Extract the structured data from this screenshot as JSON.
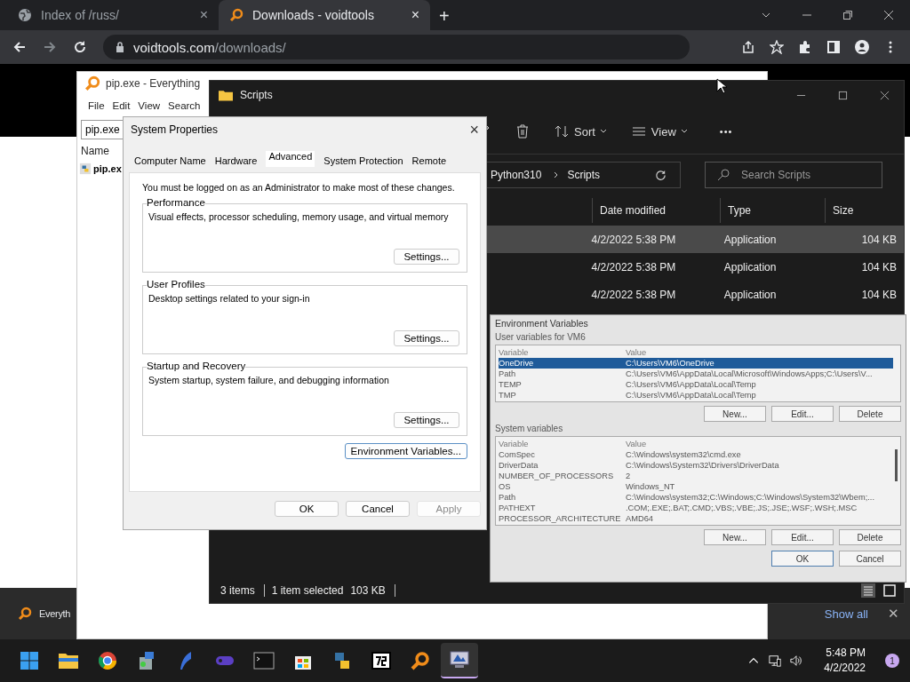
{
  "browser": {
    "tabs": [
      {
        "title": "Index of /russ/",
        "close": "×",
        "selected": false
      },
      {
        "title": "Downloads - voidtools",
        "close": "×",
        "selected": true
      }
    ],
    "new_tab": "+",
    "url_host": "voidtools.com",
    "url_path": "/downloads/"
  },
  "download_bar": {
    "item": "Everyth",
    "show_all": "Show all",
    "close": "✕"
  },
  "everything": {
    "title": "pip.exe - Everything",
    "menu": [
      "File",
      "Edit",
      "View",
      "Search"
    ],
    "search": "pip.exe",
    "column": "Name",
    "rows": [
      {
        "name": "pip.ex"
      }
    ]
  },
  "explorer": {
    "title": "Scripts",
    "toolbar": {
      "sort": "Sort",
      "view": "View",
      "more": "•••"
    },
    "breadcrumb": [
      "Python310",
      "Scripts"
    ],
    "search_placeholder": "Search Scripts",
    "columns": [
      "Date modified",
      "Type",
      "Size"
    ],
    "rows": [
      {
        "date": "4/2/2022 5:38 PM",
        "type": "Application",
        "size": "104 KB",
        "selected": true
      },
      {
        "date": "4/2/2022 5:38 PM",
        "type": "Application",
        "size": "104 KB",
        "selected": false
      },
      {
        "date": "4/2/2022 5:38 PM",
        "type": "Application",
        "size": "104 KB",
        "selected": false
      }
    ],
    "status": {
      "count": "3 items",
      "selection": "1 item selected",
      "size": "103 KB"
    }
  },
  "env_vars": {
    "title": "Environment Variables",
    "user_label": "User variables for VM6",
    "user_columns": [
      "Variable",
      "Value"
    ],
    "system_columns": [
      "Variable",
      "Value"
    ],
    "user_rows": [
      {
        "name": "OneDrive",
        "value": "C:\\Users\\VM6\\OneDrive",
        "selected": true
      },
      {
        "name": "Path",
        "value": "C:\\Users\\VM6\\AppData\\Local\\Microsoft\\WindowsApps;C:\\Users\\V...",
        "selected": false
      },
      {
        "name": "TEMP",
        "value": "C:\\Users\\VM6\\AppData\\Local\\Temp",
        "selected": false
      },
      {
        "name": "TMP",
        "value": "C:\\Users\\VM6\\AppData\\Local\\Temp",
        "selected": false
      }
    ],
    "user_buttons": [
      "New...",
      "Edit...",
      "Delete"
    ],
    "system_label": "System variables",
    "system_rows": [
      {
        "name": "ComSpec",
        "value": "C:\\Windows\\system32\\cmd.exe"
      },
      {
        "name": "DriverData",
        "value": "C:\\Windows\\System32\\Drivers\\DriverData"
      },
      {
        "name": "NUMBER_OF_PROCESSORS",
        "value": "2"
      },
      {
        "name": "OS",
        "value": "Windows_NT"
      },
      {
        "name": "Path",
        "value": "C:\\Windows\\system32;C:\\Windows;C:\\Windows\\System32\\Wbem;..."
      },
      {
        "name": "PATHEXT",
        "value": ".COM;.EXE;.BAT;.CMD;.VBS;.VBE;.JS;.JSE;.WSF;.WSH;.MSC"
      },
      {
        "name": "PROCESSOR_ARCHITECTURE",
        "value": "AMD64"
      }
    ],
    "system_buttons": [
      "New...",
      "Edit...",
      "Delete"
    ],
    "ok": "OK",
    "cancel": "Cancel"
  },
  "system_properties": {
    "title": "System Properties",
    "close": "×",
    "tabs": [
      {
        "label": "Computer Name",
        "selected": false
      },
      {
        "label": "Hardware",
        "selected": false
      },
      {
        "label": "Advanced",
        "selected": true
      },
      {
        "label": "System Protection",
        "selected": false
      },
      {
        "label": "Remote",
        "selected": false
      }
    ],
    "notice": "You must be logged on as an Administrator to make most of these changes.",
    "groups": [
      {
        "title": "Performance",
        "description": "Visual effects, processor scheduling, memory usage, and virtual memory",
        "button": "Settings..."
      },
      {
        "title": "User Profiles",
        "description": "Desktop settings related to your sign-in",
        "button": "Settings..."
      },
      {
        "title": "Startup and Recovery",
        "description": "System startup, system failure, and debugging information",
        "button": "Settings..."
      }
    ],
    "env_button": "Environment Variables...",
    "buttons": [
      {
        "label": "OK",
        "disabled": false
      },
      {
        "label": "Cancel",
        "disabled": false
      },
      {
        "label": "Apply",
        "disabled": true
      }
    ]
  },
  "taskbar": {
    "apps": [
      {
        "active": false
      },
      {
        "active": false
      },
      {
        "active": false
      },
      {
        "active": false
      },
      {
        "active": false
      },
      {
        "active": false
      },
      {
        "active": false
      },
      {
        "active": false
      },
      {
        "active": false
      },
      {
        "active": false
      },
      {
        "active": false
      },
      {
        "active": true
      }
    ],
    "time": "5:48 PM",
    "date": "4/2/2022",
    "badge": "1"
  }
}
